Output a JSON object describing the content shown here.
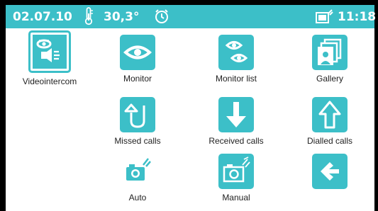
{
  "status": {
    "date": "02.07.10",
    "temperature": "30,3°",
    "time": "11:18",
    "icons": [
      "thermometer-icon",
      "alarm-clock-icon",
      "camera-memory-icon"
    ]
  },
  "menu": {
    "items": [
      {
        "label": "Videointercom",
        "icon": "videointercom-icon",
        "selected": true
      },
      {
        "label": "Monitor",
        "icon": "eye-icon"
      },
      {
        "label": "Monitor list",
        "icon": "eye-list-icon"
      },
      {
        "label": "Gallery",
        "icon": "gallery-icon"
      },
      {
        "label": "Missed calls",
        "icon": "missed-call-arrow-icon"
      },
      {
        "label": "Received calls",
        "icon": "down-arrow-icon"
      },
      {
        "label": "Dialled calls",
        "icon": "up-arrow-icon"
      },
      {
        "label": "Auto",
        "icon": "camera-auto-icon"
      },
      {
        "label": "Manual",
        "icon": "camera-manual-icon"
      },
      {
        "label": "",
        "icon": "back-arrow-icon"
      }
    ]
  },
  "colors": {
    "accent": "#3cbfc8",
    "background": "#000000",
    "panel": "#ffffff"
  }
}
